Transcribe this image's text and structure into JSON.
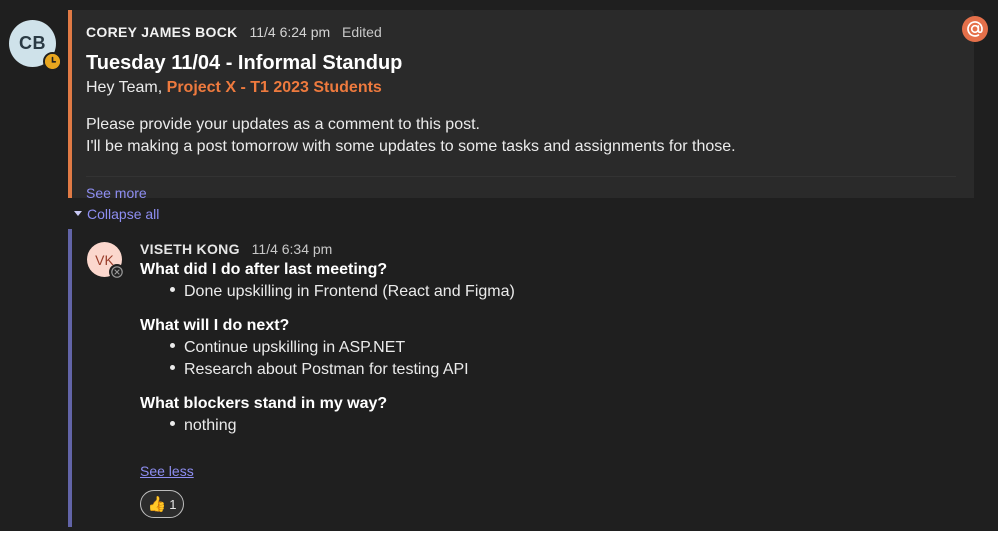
{
  "post": {
    "author_initials": "CB",
    "author_name": "COREY JAMES BOCK",
    "time": "11/4 6:24 pm",
    "edited_label": "Edited",
    "title": "Tuesday 11/04 - Informal Standup",
    "greeting": "Hey Team,",
    "mention": "Project X - T1 2023 Students",
    "body_line_1": "Please provide your updates as a comment to this post.",
    "body_line_2": "I'll be making a post tomorrow with some updates to some tasks and assignments for those.",
    "see_more_label": "See more",
    "accent_color": "#e07a45",
    "status_icon": "clock-away-icon"
  },
  "mention_badge_icon": "at-icon",
  "thread": {
    "collapse_label": "Collapse all",
    "accent_color": "#6264a7"
  },
  "reply": {
    "author_initials": "VK",
    "author_name": "VISETH KONG",
    "time": "11/4 6:34 pm",
    "status_icon": "offline-icon",
    "sections": [
      {
        "heading": "What did I do after last meeting?",
        "bullets": [
          "Done upskilling in Frontend (React and Figma)"
        ]
      },
      {
        "heading": "What will I do next?",
        "bullets": [
          "Continue upskilling in ASP.NET",
          "Research about Postman for testing API"
        ]
      },
      {
        "heading": "What blockers stand in my way?",
        "bullets": [
          "nothing"
        ]
      }
    ],
    "see_less_label": "See less",
    "reaction": {
      "emoji": "👍",
      "icon": "thumbs-up-icon",
      "count": "1"
    }
  }
}
